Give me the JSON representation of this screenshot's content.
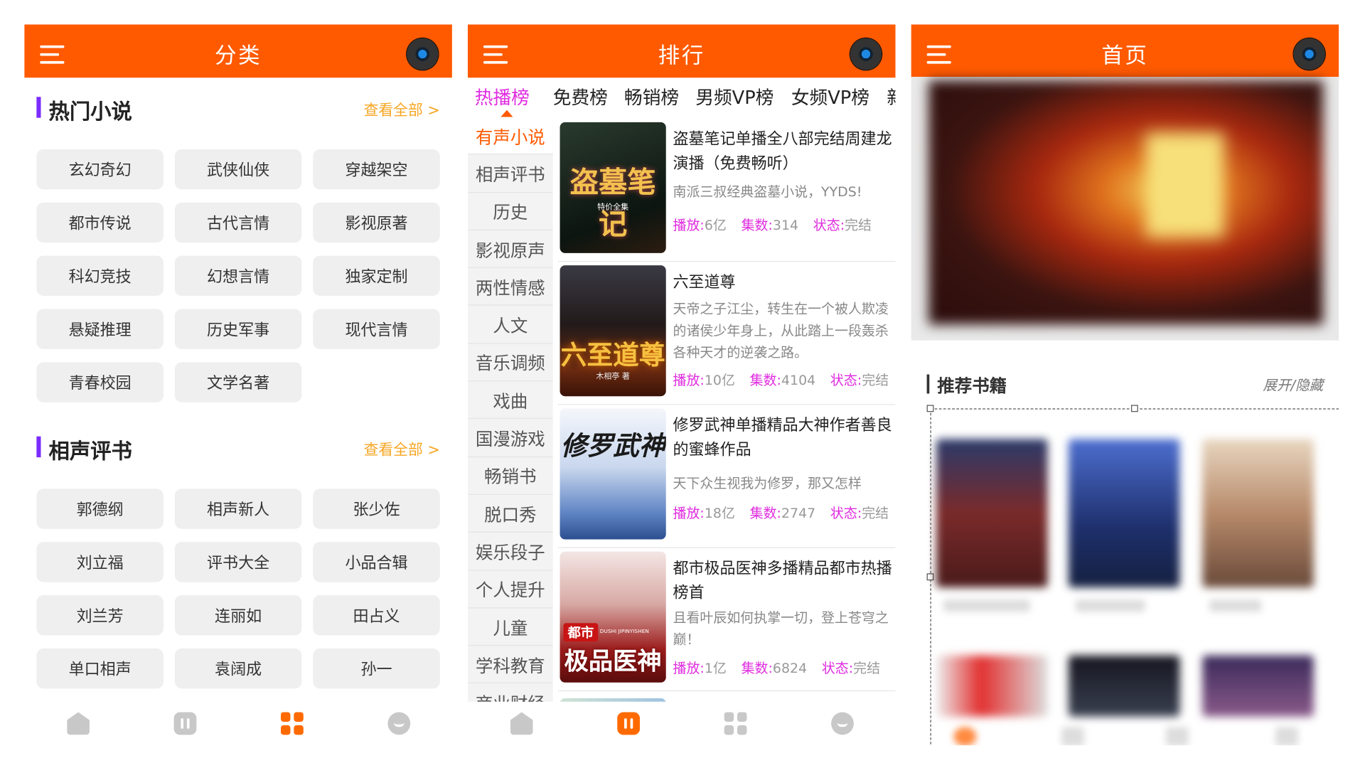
{
  "colors": {
    "accent": "#ff5a00",
    "purple": "#7b2cff",
    "more": "#f6a623",
    "tab_active": "#e02ce0"
  },
  "category": {
    "title": "分类",
    "sections": [
      {
        "title": "热门小说",
        "more": "查看全部 >",
        "tags": [
          "玄幻奇幻",
          "武侠仙侠",
          "穿越架空",
          "都市传说",
          "古代言情",
          "影视原著",
          "科幻竞技",
          "幻想言情",
          "独家定制",
          "悬疑推理",
          "历史军事",
          "现代言情",
          "青春校园",
          "文学名著"
        ]
      },
      {
        "title": "相声评书",
        "more": "查看全部 >",
        "tags": [
          "郭德纲",
          "相声新人",
          "张少佐",
          "刘立福",
          "评书大全",
          "小品合辑",
          "刘兰芳",
          "连丽如",
          "田占义",
          "单口相声",
          "袁阔成",
          "孙一"
        ]
      }
    ]
  },
  "ranking": {
    "title": "排行",
    "tabs": [
      "热播榜",
      "免费榜",
      "畅销榜",
      "男频VP榜",
      "女频VP榜",
      "新"
    ],
    "side": [
      "有声小说",
      "相声评书",
      "历史",
      "影视原声",
      "两性情感",
      "人文",
      "音乐调频",
      "戏曲",
      "国漫游戏",
      "畅销书",
      "脱口秀",
      "娱乐段子",
      "个人提升",
      "儿童",
      "学科教育",
      "商业财经"
    ],
    "meta_labels": {
      "plays": "播放:",
      "episodes": "集数:",
      "status": "状态:"
    },
    "books": [
      {
        "title": "盗墓笔记单播全八部完结周建龙演播（免费畅听）",
        "desc": "南派三叔经典盗墓小说，YYDS!",
        "plays": "6亿",
        "episodes": "314",
        "status": "完结",
        "cover_text": "盗墓笔记",
        "cover_sub": "特价全集"
      },
      {
        "title": "六至道尊",
        "desc": "天帝之子江尘，转生在一个被人欺凌的诸侯少年身上，从此踏上一段轰杀各种天才的逆袭之路。",
        "plays": "10亿",
        "episodes": "4104",
        "status": "完结",
        "cover_text": "六至道尊",
        "cover_sub": "木相亭 著"
      },
      {
        "title": "修罗武神单播精品大神作者善良的蜜蜂作品",
        "desc": "天下众生视我为修罗，那又怎样",
        "plays": "18亿",
        "episodes": "2747",
        "status": "完结",
        "cover_text": "修罗武神",
        "cover_sub": ""
      },
      {
        "title": "都市极品医神多播精品都市热播榜首",
        "desc": "且看叶辰如何执掌一切，登上苍穹之巅！",
        "plays": "1亿",
        "episodes": "6824",
        "status": "完结",
        "cover_text": "极品医神",
        "cover_badge": "都市",
        "cover_sub": "DUSHI JIPINYISHEN"
      }
    ]
  },
  "home": {
    "title": "首页",
    "recommend_title": "推荐书籍",
    "recommend_toggle": "展开/隐藏"
  },
  "tabbar_icons": [
    "home-icon",
    "voice-icon",
    "category-icon",
    "profile-icon"
  ]
}
